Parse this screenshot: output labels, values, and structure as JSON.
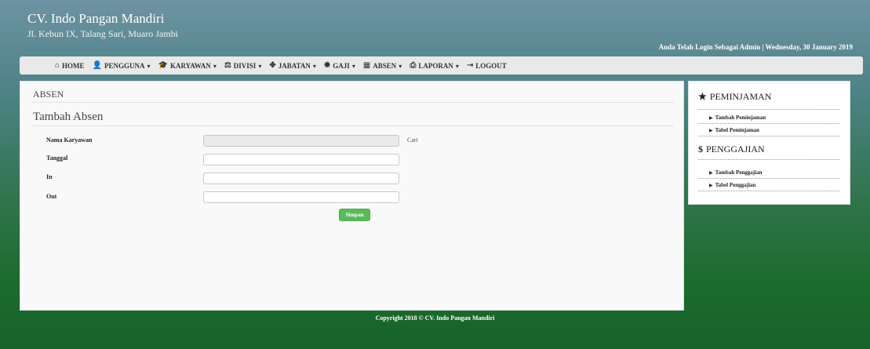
{
  "header": {
    "company": "CV. Indo Pangan Mandiri",
    "address": "Jl. Kebun IX, Talang Sari, Muaro Jambi",
    "login_info": "Anda Telah Login Sebagai Admin | Wednesday, 30 January 2019"
  },
  "nav": {
    "home": "HOME",
    "pengguna": "PENGGUNA",
    "karyawan": "KARYAWAN",
    "divisi": "DIVISI",
    "jabatan": "JABATAN",
    "gaji": "GAJI",
    "absen": "ABSEN",
    "laporan": "LAPORAN",
    "logout": "LOGOUT",
    "dropdown_caret": "▾"
  },
  "content": {
    "breadcrumb": "ABSEN",
    "form_title": "Tambah Absen",
    "fields": {
      "nama_karyawan": {
        "label": "Nama Karyawan",
        "value": ""
      },
      "tanggal": {
        "label": "Tanggal",
        "value": ""
      },
      "in": {
        "label": "In",
        "value": ""
      },
      "out": {
        "label": "Out",
        "value": ""
      }
    },
    "cari_label": "Cari",
    "save_label": "Simpan"
  },
  "sidebar": {
    "peminjaman_title": "PEMINJAMAN",
    "tambah_peminjaman": "Tambah Peminjaman",
    "tabel_peminjaman": "Tabel Peminjaman",
    "penggajian_title": "PENGGAJIAN",
    "tambah_penggajian": "Tambah Penggajian",
    "tabel_penggajian": "Tabel Penggajian"
  },
  "footer": {
    "copyright": "Copyright 2018 © CV. Indo Pangan Mandiri"
  },
  "colors": {
    "save_button": "#5cb85c",
    "navbar_bg": "#e9e9e9",
    "header_top": "#6e93a3",
    "page_bottom": "#17632a"
  },
  "icons": {
    "home": "home-icon",
    "pengguna": "user-icon",
    "karyawan": "graduation-cap-icon",
    "divisi": "scale-icon",
    "jabatan": "crosshair-icon",
    "gaji": "certificate-icon",
    "absen": "calendar-icon",
    "laporan": "print-icon",
    "logout": "logout-icon",
    "peminjaman": "star-icon",
    "penggajian": "dollar-icon"
  }
}
